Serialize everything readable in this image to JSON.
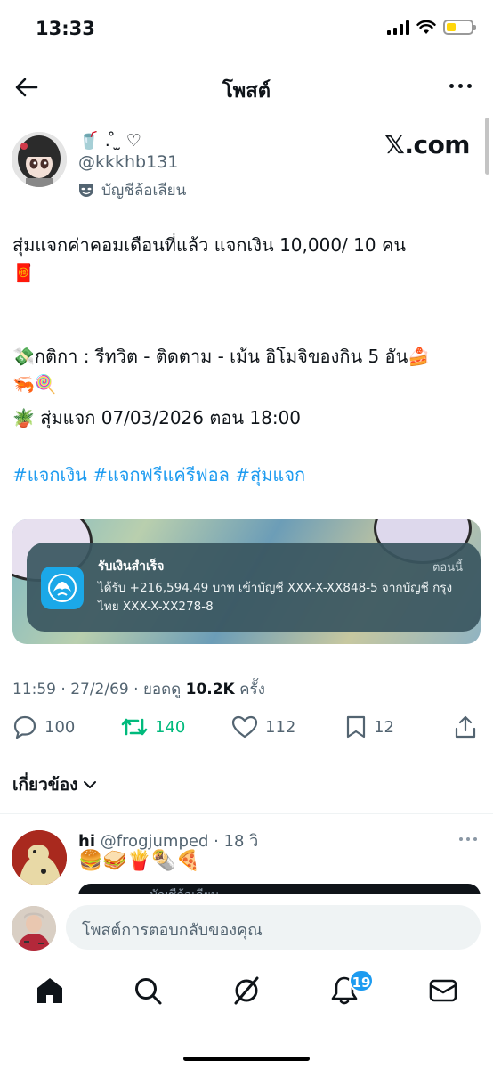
{
  "status_bar": {
    "time": "13:33"
  },
  "header": {
    "title": "โพสต์"
  },
  "post": {
    "display_name": "🥤 . ̊ ̫ ♡",
    "handle": "@kkkhb131",
    "account_label": "บัญชีล้อเลียน",
    "source_logo": "𝕏.com",
    "lines": [
      "สุ่มแจกค่าคอมเดือนที่แล้ว แจกเงิน 10,000/ 10 คน",
      "🧧",
      "💸กติกา : รีทวิต - ติดตาม - เม้น อิโมจิของกิน 5 อัน🍰",
      "🦐🍭",
      "🪴 สุ่มแจก 07/03/2026 ตอน 18:00"
    ],
    "hashtags": "#แจกเงิน #แจกฟรีแค่รีฟอล #สุ่มแจก",
    "media": {
      "notification_title": "รับเงินสำเร็จ",
      "notification_time": "ตอนนี้",
      "notification_body": "ได้รับ +216,594.49 บาท เข้าบัญชี XXX-X-XX848-5 จากบัญชี กรุงไทย XXX-X-XX278-8"
    },
    "meta": {
      "time_date": "11:59 · 27/2/69 · ยอดดู",
      "views": "10.2K",
      "views_suffix": "ครั้ง"
    },
    "actions": {
      "replies": "100",
      "reposts": "140",
      "likes": "112",
      "bookmarks": "12"
    },
    "related_label": "เกี่ยวข้อง"
  },
  "reply": {
    "name": "hi",
    "handle": "@frogjumped",
    "time": "· 18 วิ",
    "emojis": "🍔🥪🍟🌯🍕",
    "quote_label": "บัญชีล้อเลียน"
  },
  "compose": {
    "placeholder": "โพสต์การตอบกลับของคุณ"
  },
  "tabbar": {
    "notifications_badge": "19"
  },
  "colors": {
    "accent": "#1d9bf0",
    "repost_green": "#00ba7c",
    "muted": "#536471"
  },
  "icons": [
    "back-arrow-icon",
    "more-icon",
    "parody-mask-icon",
    "reply-icon",
    "repost-icon",
    "like-icon",
    "bookmark-icon",
    "share-icon",
    "chevron-down-icon",
    "home-icon",
    "search-icon",
    "grok-icon",
    "bell-icon",
    "mail-icon"
  ]
}
